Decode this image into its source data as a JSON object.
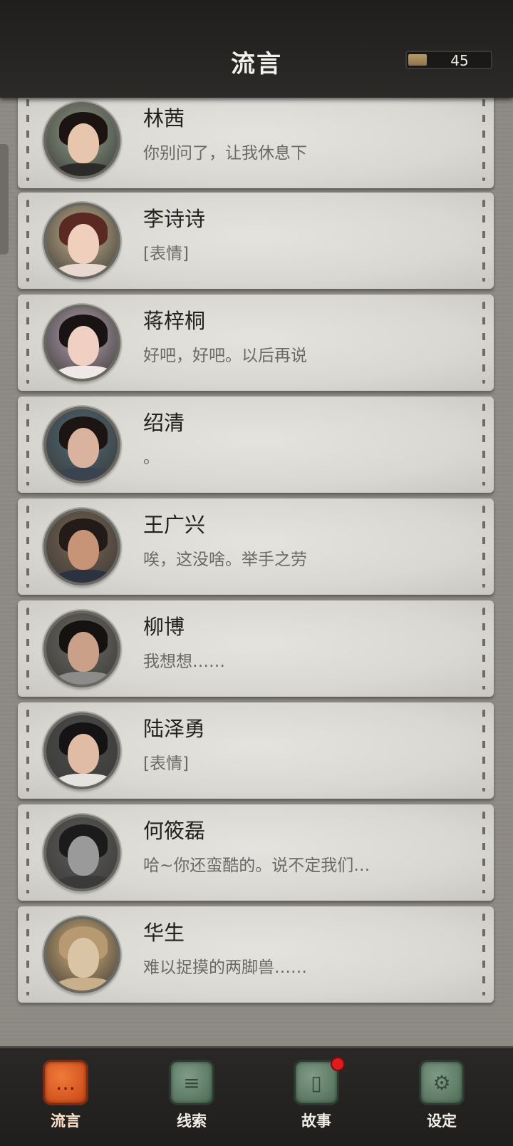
{
  "header": {
    "title": "流言",
    "counter_value": "45"
  },
  "contacts": [
    {
      "name": "林茜",
      "message": "你别问了，让我休息下",
      "skin": "#e8c6ad",
      "hair": "#1b1412",
      "body": "#2d2a2a",
      "bg": "#8fa08a"
    },
    {
      "name": "李诗诗",
      "message": "[表情]",
      "skin": "#f0cfbd",
      "hair": "#5a2a22",
      "body": "#e9d8cf",
      "bg": "#c9b48d"
    },
    {
      "name": "蒋梓桐",
      "message": "好吧，好吧。以后再说",
      "skin": "#efd0c3",
      "hair": "#1a1313",
      "body": "#efe8e6",
      "bg": "#b7a2b5"
    },
    {
      "name": "绍清",
      "message": "。",
      "skin": "#d9b39e",
      "hair": "#1c1514",
      "body": "#3b4250",
      "bg": "#4d6a78"
    },
    {
      "name": "王广兴",
      "message": "唉，这没啥。举手之劳",
      "skin": "#c89478",
      "hair": "#231b17",
      "body": "#2c3340",
      "bg": "#7a6452"
    },
    {
      "name": "柳博",
      "message": "我想想……",
      "skin": "#caa088",
      "hair": "#151211",
      "body": "#8e8c8a",
      "bg": "#6c6a66"
    },
    {
      "name": "陆泽勇",
      "message": "[表情]",
      "skin": "#e0bca5",
      "hair": "#151313",
      "body": "#e5e3e0",
      "bg": "#4a4d4d"
    },
    {
      "name": "何筱磊",
      "message": "哈~你还蛮酷的。说不定我们…",
      "skin": "#9a9a9a",
      "hair": "#1b1b1b",
      "body": "#3a3a3a",
      "bg": "#5c5c5c"
    },
    {
      "name": "华生",
      "message": "难以捉摸的两脚兽……",
      "skin": "#d9c4a6",
      "hair": "#b89a72",
      "body": "#c9b08a",
      "bg": "#d8b27a"
    }
  ],
  "nav": [
    {
      "label": "流言",
      "icon": "chat-bubble-icon",
      "glyph": "…",
      "active": true,
      "badge": false
    },
    {
      "label": "线索",
      "icon": "document-icon",
      "glyph": "≡",
      "active": false,
      "badge": false
    },
    {
      "label": "故事",
      "icon": "book-icon",
      "glyph": "▯",
      "active": false,
      "badge": true
    },
    {
      "label": "设定",
      "icon": "gear-icon",
      "glyph": "⚙",
      "active": false,
      "badge": false
    }
  ]
}
